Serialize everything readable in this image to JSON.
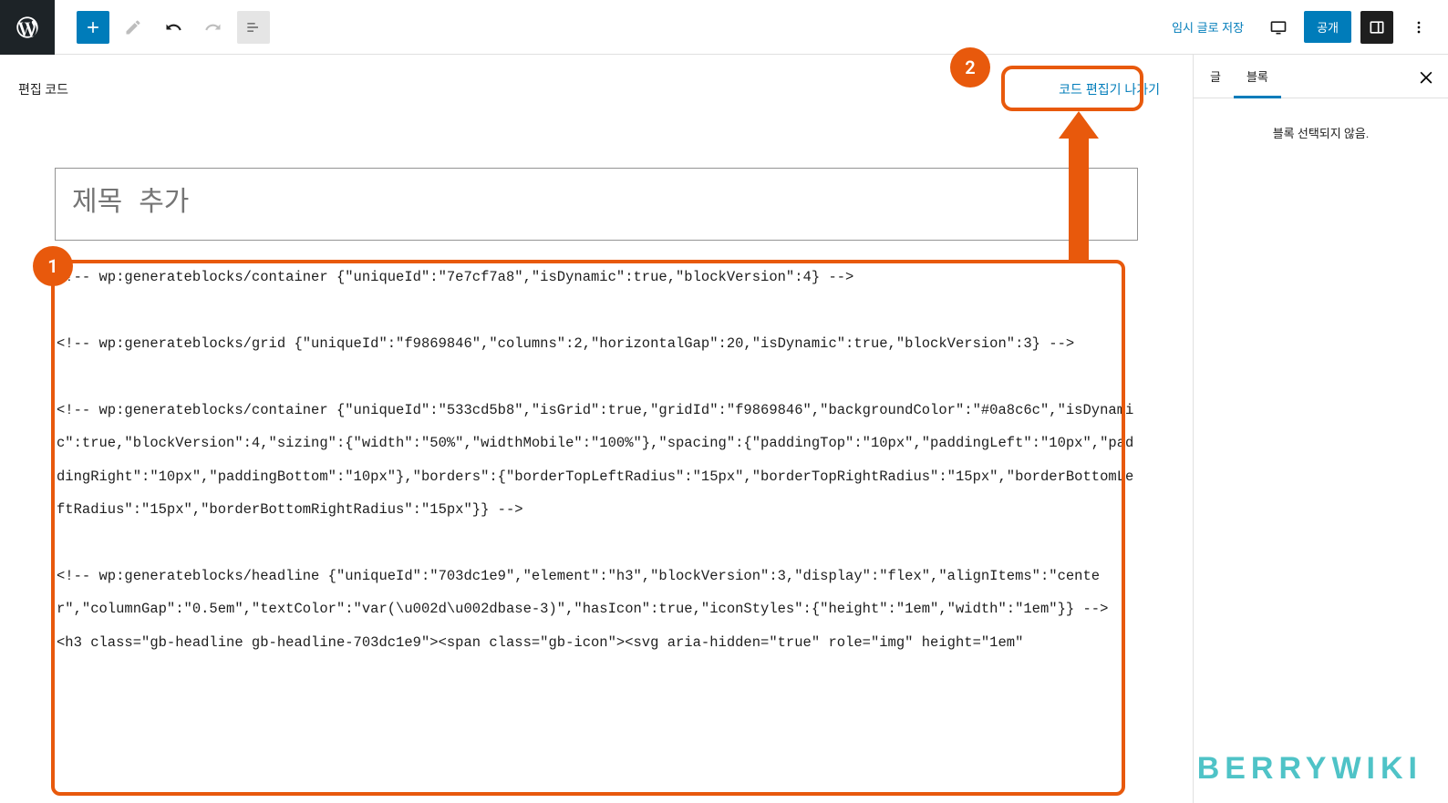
{
  "toolbar": {
    "save_draft_label": "임시 글로 저장",
    "publish_label": "공개"
  },
  "code_header": {
    "label": "편집 코드",
    "exit_label": "코드 편집기 나가기"
  },
  "title": {
    "placeholder": "제목 추가"
  },
  "code": {
    "content": "<!-- wp:generateblocks/container {\"uniqueId\":\"7e7cf7a8\",\"isDynamic\":true,\"blockVersion\":4} -->\n\n<!-- wp:generateblocks/grid {\"uniqueId\":\"f9869846\",\"columns\":2,\"horizontalGap\":20,\"isDynamic\":true,\"blockVersion\":3} -->\n\n<!-- wp:generateblocks/container {\"uniqueId\":\"533cd5b8\",\"isGrid\":true,\"gridId\":\"f9869846\",\"backgroundColor\":\"#0a8c6c\",\"isDynamic\":true,\"blockVersion\":4,\"sizing\":{\"width\":\"50%\",\"widthMobile\":\"100%\"},\"spacing\":{\"paddingTop\":\"10px\",\"paddingLeft\":\"10px\",\"paddingRight\":\"10px\",\"paddingBottom\":\"10px\"},\"borders\":{\"borderTopLeftRadius\":\"15px\",\"borderTopRightRadius\":\"15px\",\"borderBottomLeftRadius\":\"15px\",\"borderBottomRightRadius\":\"15px\"}} -->\n\n<!-- wp:generateblocks/headline {\"uniqueId\":\"703dc1e9\",\"element\":\"h3\",\"blockVersion\":3,\"display\":\"flex\",\"alignItems\":\"center\",\"columnGap\":\"0.5em\",\"textColor\":\"var(\\u002d\\u002dbase-3)\",\"hasIcon\":true,\"iconStyles\":{\"height\":\"1em\",\"width\":\"1em\"}} -->\n<h3 class=\"gb-headline gb-headline-703dc1e9\"><span class=\"gb-icon\"><svg aria-hidden=\"true\" role=\"img\" height=\"1em\""
  },
  "sidebar": {
    "tab_post": "글",
    "tab_block": "블록",
    "no_block_selected": "블록 선택되지 않음."
  },
  "annotations": {
    "badge1": "1",
    "badge2": "2"
  },
  "watermark": "BERRYWIKI"
}
